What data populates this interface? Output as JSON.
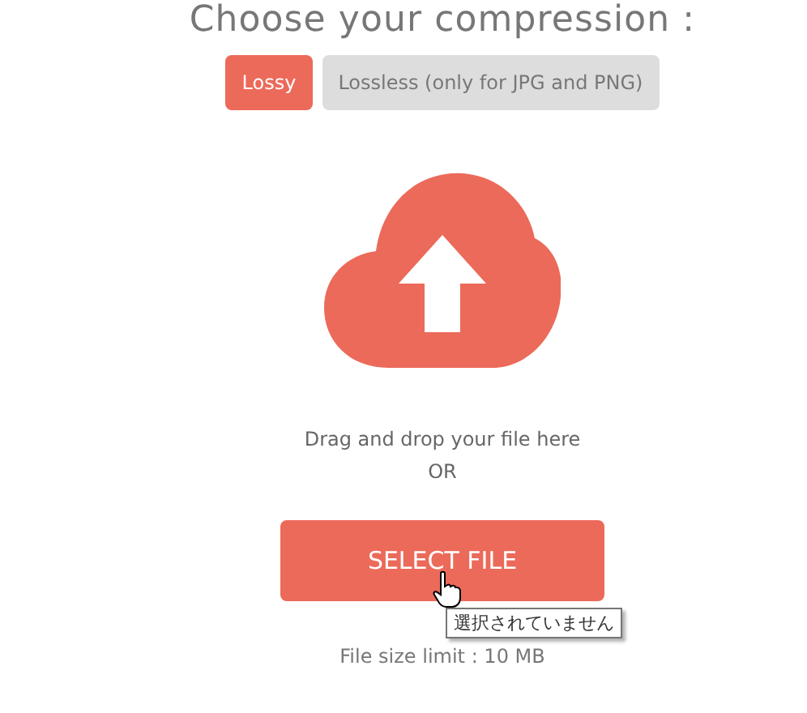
{
  "title": "Choose your compression :",
  "modes": [
    {
      "label": "Lossy",
      "selected": true
    },
    {
      "label": "Lossless (only for JPG and PNG)",
      "selected": false
    }
  ],
  "drop_hint": "Drag and drop your file here",
  "or": "OR",
  "select_button": "SELECT FILE",
  "tooltip": "選択されていません",
  "size_limit": "File size limit : 10 MB"
}
